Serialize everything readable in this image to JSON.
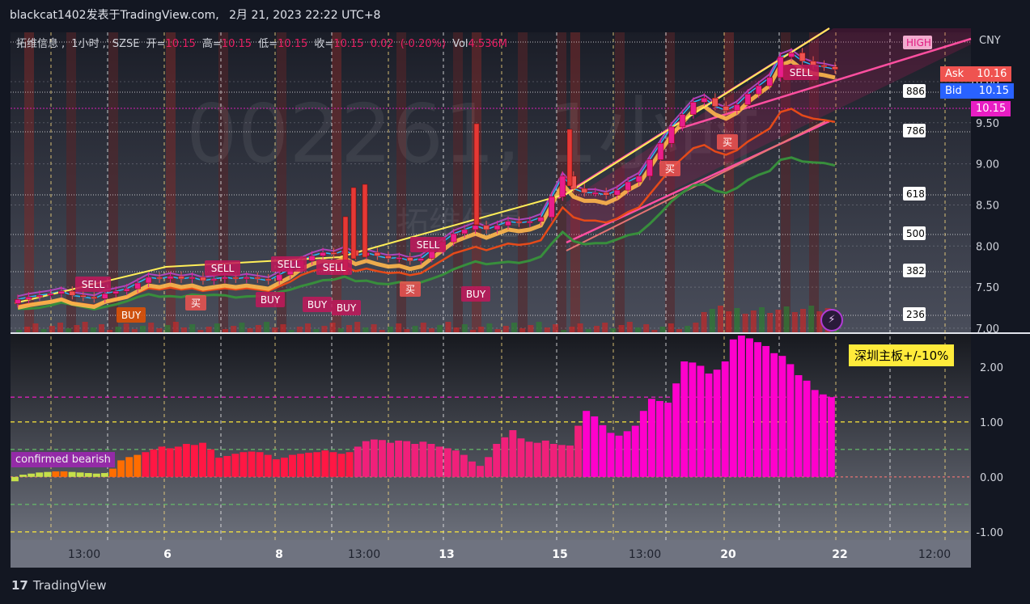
{
  "header": {
    "author": "blackcat1402",
    "published_on": "发表于TradingView.com,",
    "timestamp": "2月 21, 2023 22:22 UTC+8"
  },
  "legend": {
    "symbol": "拓维信息",
    "interval": "1小时",
    "exchange": "SZSE",
    "open_label": "开=",
    "open": "10.15",
    "high_label": "高=",
    "high": "10.15",
    "low_label": "低=",
    "low": "10.15",
    "close_label": "收=",
    "close": "10.15",
    "change": "0.02",
    "change_pct": "(-0.20%)",
    "vol_label": "Vol",
    "vol": "4.536M"
  },
  "watermark": {
    "big": "002261, 1小时",
    "small": "拓维信息"
  },
  "price_scale": {
    "currency": "CNY",
    "ask_label": "Ask",
    "ask": "10.16",
    "bid_label": "Bid",
    "bid": "10.15",
    "last": "10.15"
  },
  "fib_levels": [
    "HIGH",
    "886",
    "786",
    "618",
    "500",
    "382",
    "236"
  ],
  "market_badge": "深圳主板+/-10%",
  "status_pill": "confirmed bearish",
  "logo_text": "TradingView",
  "colors": {
    "background": "#131722",
    "up": "#e91e8c",
    "down": "#ef5350",
    "grid_dotted": "#d1d4dc",
    "accent_yellow": "#ffeb3b",
    "bar_magenta": "#ff00cc",
    "bar_red": "#ff1744",
    "bar_orange": "#ff6d00"
  },
  "chart_data": [
    {
      "type": "candlestick",
      "title": "",
      "x_ticks": [
        "13:00",
        "6",
        "8",
        "13:00",
        "13",
        "15",
        "13:00",
        "20",
        "22",
        "12:00"
      ],
      "y_ticks": [
        7.0,
        7.5,
        8.0,
        8.5,
        9.0,
        9.5,
        10.0
      ],
      "ylim": [
        6.95,
        10.6
      ],
      "close": [
        7.35,
        7.38,
        7.4,
        7.42,
        7.45,
        7.4,
        7.38,
        7.36,
        7.42,
        7.45,
        7.48,
        7.55,
        7.62,
        7.6,
        7.63,
        7.6,
        7.62,
        7.58,
        7.6,
        7.62,
        7.6,
        7.62,
        7.6,
        7.58,
        7.65,
        7.72,
        7.82,
        7.88,
        7.92,
        7.9,
        7.95,
        7.88,
        7.92,
        7.88,
        7.85,
        7.86,
        7.82,
        7.85,
        7.95,
        8.05,
        8.15,
        8.2,
        8.25,
        8.2,
        8.25,
        8.3,
        8.28,
        8.3,
        8.35,
        8.6,
        8.85,
        8.7,
        8.65,
        8.65,
        8.62,
        8.68,
        8.78,
        8.85,
        9.05,
        9.25,
        9.45,
        9.6,
        9.75,
        9.8,
        9.7,
        9.65,
        9.72,
        9.85,
        9.95,
        10.05,
        10.3,
        10.35,
        10.25,
        10.2,
        10.18,
        10.15
      ],
      "annotations": [
        "SELL",
        "BUY",
        "SELL",
        "买",
        "SELL",
        "BUY",
        "SELL",
        "BUY",
        "BUY",
        "SELL",
        "买",
        "BUY",
        "买",
        "买",
        "SELL"
      ]
    },
    {
      "type": "bar",
      "title": "",
      "y_ticks": [
        -1.0,
        0.0,
        1.0,
        2.0
      ],
      "ylim": [
        -1.15,
        2.6
      ],
      "reference_lines": [
        1.45,
        1.0,
        0.5,
        0.0,
        -0.5,
        -1.0
      ],
      "values": [
        -0.08,
        0.04,
        0.06,
        0.08,
        0.09,
        0.1,
        0.1,
        0.09,
        0.08,
        0.07,
        0.06,
        0.07,
        0.15,
        0.3,
        0.36,
        0.4,
        0.45,
        0.5,
        0.55,
        0.52,
        0.55,
        0.6,
        0.58,
        0.62,
        0.5,
        0.35,
        0.38,
        0.42,
        0.45,
        0.46,
        0.45,
        0.4,
        0.32,
        0.35,
        0.4,
        0.42,
        0.44,
        0.45,
        0.48,
        0.45,
        0.42,
        0.45,
        0.55,
        0.65,
        0.68,
        0.67,
        0.62,
        0.66,
        0.65,
        0.6,
        0.64,
        0.6,
        0.55,
        0.52,
        0.48,
        0.4,
        0.28,
        0.2,
        0.36,
        0.6,
        0.72,
        0.85,
        0.7,
        0.64,
        0.62,
        0.66,
        0.6,
        0.58,
        0.57,
        0.93,
        1.2,
        1.1,
        0.94,
        0.8,
        0.75,
        0.83,
        0.93,
        1.2,
        1.42,
        1.38,
        1.35,
        1.7,
        2.1,
        2.08,
        2.02,
        1.88,
        1.95,
        2.1,
        2.5,
        2.57,
        2.52,
        2.45,
        2.38,
        2.25,
        2.2,
        2.05,
        1.85,
        1.75,
        1.58,
        1.5,
        1.45
      ]
    }
  ]
}
